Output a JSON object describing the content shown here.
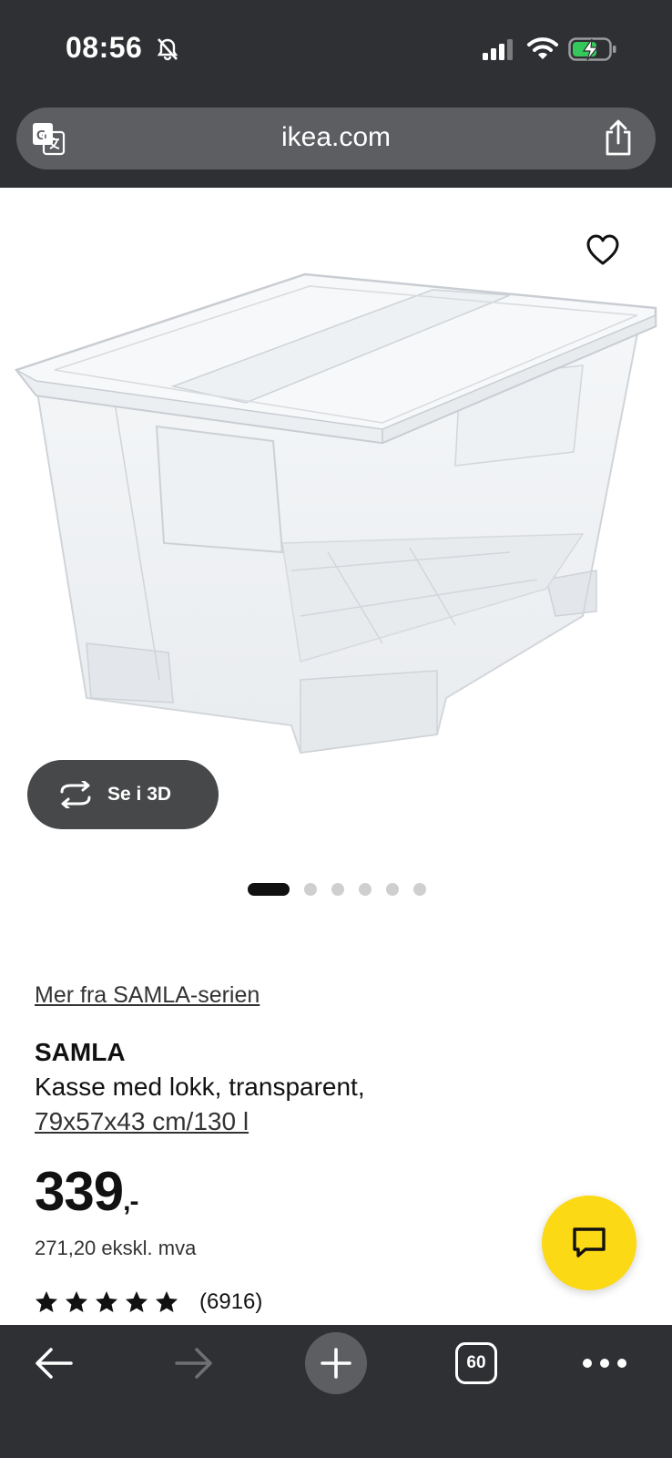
{
  "status_bar": {
    "time": "08:56",
    "silent_icon": "bell-slash-icon",
    "signal_icon": "cellular-signal-icon",
    "wifi_icon": "wifi-icon",
    "battery_icon": "battery-charging-icon"
  },
  "address_bar": {
    "translate_icon": "translate-icon",
    "url": "ikea.com",
    "share_icon": "share-icon"
  },
  "product_gallery": {
    "favourite_icon": "heart-icon",
    "view_3d_label": "Se i 3D",
    "view_3d_icon": "rotate-3d-icon",
    "image_count": 6,
    "active_image_index": 0
  },
  "product": {
    "series_link": "Mer fra SAMLA-serien",
    "name": "SAMLA",
    "description": "Kasse med lokk, transparent,",
    "size": "79x57x43 cm/130 l",
    "price_main": "339",
    "price_suffix": ",-",
    "price_ex_vat": "271,20 ekskl. mva",
    "rating_stars": 5,
    "rating_count": "(6916)"
  },
  "chat": {
    "icon": "chat-bubble-icon"
  },
  "toolbar": {
    "back_icon": "back-arrow-icon",
    "forward_icon": "forward-arrow-icon",
    "new_tab_icon": "plus-icon",
    "tab_count": "60",
    "more_icon": "more-dots-icon"
  },
  "colors": {
    "chrome_dark": "#2f3033",
    "address_bar": "#5c5e62",
    "chat_yellow": "#fbd914",
    "view_3d_button": "#474849",
    "battery_green": "#34c759"
  }
}
